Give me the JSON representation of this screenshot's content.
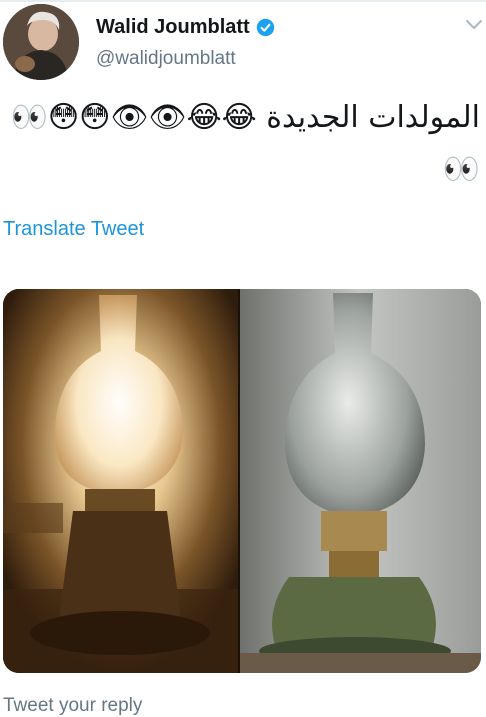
{
  "tweet": {
    "author_name": "Walid Joumblatt",
    "author_handle": "@walidjoumblatt",
    "text": "المولدات الجديدة 😂😂👁👁😳😳👀",
    "text_line2": "👀",
    "translate_label": "Translate Tweet",
    "reply_placeholder": "Tweet your reply"
  },
  "colors": {
    "link": "#1b95e0",
    "secondary_text": "#657786",
    "verified_badge": "#1da1f2"
  },
  "icons": {
    "verified": "verified-badge-icon",
    "menu": "chevron-down-icon"
  }
}
